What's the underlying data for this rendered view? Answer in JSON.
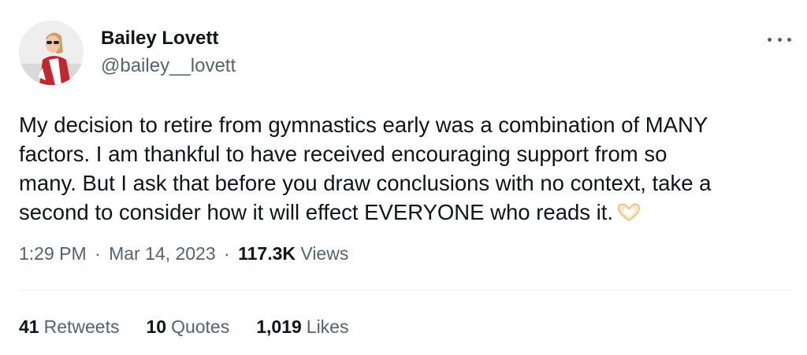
{
  "author": {
    "name": "Bailey Lovett",
    "handle": "@bailey__lovett",
    "avatar_icon": "profile-photo"
  },
  "more_icon": "more-horizontal-icon",
  "tweet": {
    "lines": [
      "My decision to retire from gymnastics early was a combination of MANY",
      "factors. I am thankful to have received encouraging support from so",
      "many. But I ask that before you draw conclusions with no context, take a",
      "second to consider how it will effect EVERYONE who reads it."
    ],
    "emoji_icon": "heart-hands-icon"
  },
  "meta": {
    "time": "1:29 PM",
    "date": "Mar 14, 2023",
    "separator": "·",
    "views_count": "117.3K",
    "views_label": "Views"
  },
  "stats": {
    "retweets_count": "41",
    "retweets_label": "Retweets",
    "quotes_count": "10",
    "quotes_label": "Quotes",
    "likes_count": "1,019",
    "likes_label": "Likes"
  },
  "colors": {
    "text_primary": "#0f1419",
    "text_secondary": "#536471",
    "divider": "#eff3f4"
  }
}
